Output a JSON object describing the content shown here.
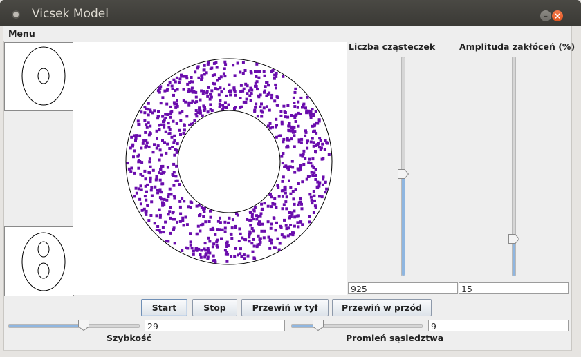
{
  "window": {
    "title": "Vicsek Model"
  },
  "menu": {
    "label": "Menu"
  },
  "sliders": {
    "particles": {
      "label": "Liczba cząsteczek",
      "value": "925",
      "level": 0.46
    },
    "noise": {
      "label": "Amplituda zakłóceń (%)",
      "value": "15",
      "level": 0.15
    },
    "speed": {
      "label": "Szybkość",
      "value": "29",
      "level": 0.59
    },
    "radius": {
      "label": "Promień sąsiedztwa",
      "value": "9",
      "level": 0.18
    }
  },
  "buttons": {
    "start": "Start",
    "stop": "Stop",
    "rewind": "Przewiń w tył",
    "forward": "Przewiń w przód"
  },
  "simulation": {
    "particle_count": 925,
    "particle_color": "#6a0dad",
    "boundary_color": "#000000"
  },
  "colors": {
    "slider_fill": "#8fb6e0",
    "close_button": "#e0541f"
  }
}
